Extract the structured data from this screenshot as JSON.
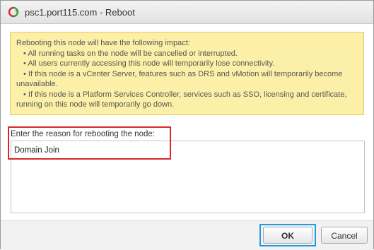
{
  "window": {
    "title": "psc1.port115.com - Reboot",
    "icon": "reboot-icon"
  },
  "warning": {
    "intro": "Rebooting this node will have the following impact:",
    "bullets": [
      "All running tasks on the node will be cancelled or interrupted.",
      "All users currently accessing this node will temporarily lose connectivity.",
      "If this node is a vCenter Server, features such as DRS and vMotion will temporarily become unavailable.",
      "If this node is a Platform Services Controller, services such as SSO, licensing and certificate, running on this node will temporarily go down."
    ]
  },
  "reason": {
    "label": "Enter the reason for rebooting the node:",
    "value": "Domain Join"
  },
  "buttons": {
    "ok_label": "OK",
    "cancel_label": "Cancel"
  },
  "colors": {
    "warning_bg": "#fcf0a8",
    "warning_border": "#e8c860",
    "annotation_red": "#d9262e",
    "annotation_blue": "#1f9be0",
    "icon_red": "#d32f2f",
    "icon_green": "#43a047"
  }
}
